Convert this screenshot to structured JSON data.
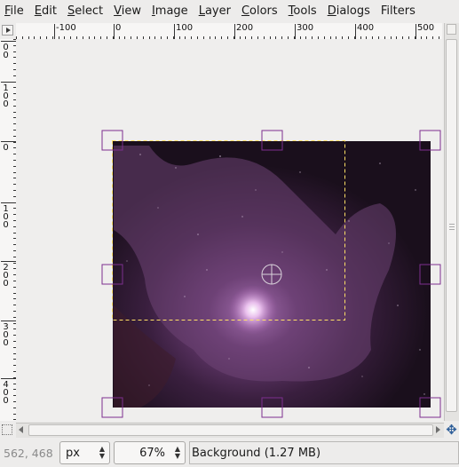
{
  "menubar": {
    "items": [
      {
        "mnemonic": "F",
        "rest": "ile"
      },
      {
        "mnemonic": "E",
        "rest": "dit"
      },
      {
        "mnemonic": "S",
        "rest": "elect"
      },
      {
        "mnemonic": "V",
        "rest": "iew"
      },
      {
        "mnemonic": "I",
        "rest": "mage"
      },
      {
        "mnemonic": "L",
        "rest": "ayer"
      },
      {
        "mnemonic": "C",
        "rest": "olors"
      },
      {
        "mnemonic": "T",
        "rest": "ools"
      },
      {
        "mnemonic": "D",
        "rest": "ialogs"
      },
      {
        "mnemonic": "",
        "rest": "Filters"
      }
    ]
  },
  "rulers": {
    "horizontal_labels": [
      "-100",
      "0",
      "100",
      "200",
      "300",
      "400",
      "500"
    ],
    "vertical_labels": [
      "00",
      "100",
      "0",
      "100",
      "200",
      "300",
      "400"
    ]
  },
  "canvas": {
    "layer_colors": {
      "nebula_dark": "#1b0f1c",
      "nebula_mid": "#5b3560",
      "nebula_light": "#7a4d80",
      "selection": "#ffe066",
      "handles": "#7d2f8f"
    }
  },
  "statusbar": {
    "pointer_coords": "562, 468",
    "unit": "px",
    "zoom": "67%",
    "layer_info": "Background (1.27 MB)"
  }
}
